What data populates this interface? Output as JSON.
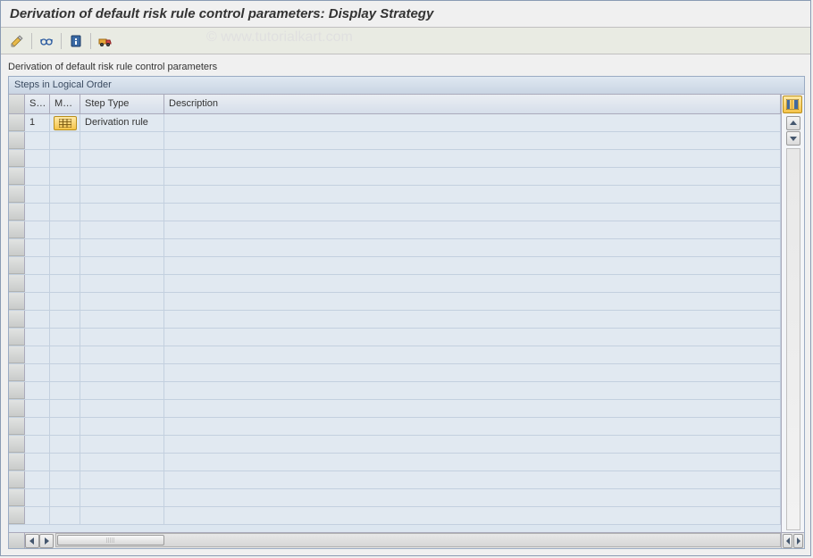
{
  "title": "Derivation of default risk rule control parameters: Display Strategy",
  "watermark": "© www.tutorialkart.com",
  "section_label": "Derivation of default risk rule control parameters",
  "panel_title": "Steps in Logical Order",
  "columns": {
    "step": "St...",
    "maint": "Ma...",
    "type": "Step Type",
    "desc": "Description"
  },
  "toolbar": {
    "edit": "edit-toggle-icon",
    "glasses": "display-icon",
    "info": "info-icon",
    "transport": "transport-icon"
  },
  "rows": [
    {
      "step": "1",
      "maint_icon": "grid-icon",
      "type": "Derivation rule",
      "desc": ""
    }
  ],
  "empty_rows": 22
}
